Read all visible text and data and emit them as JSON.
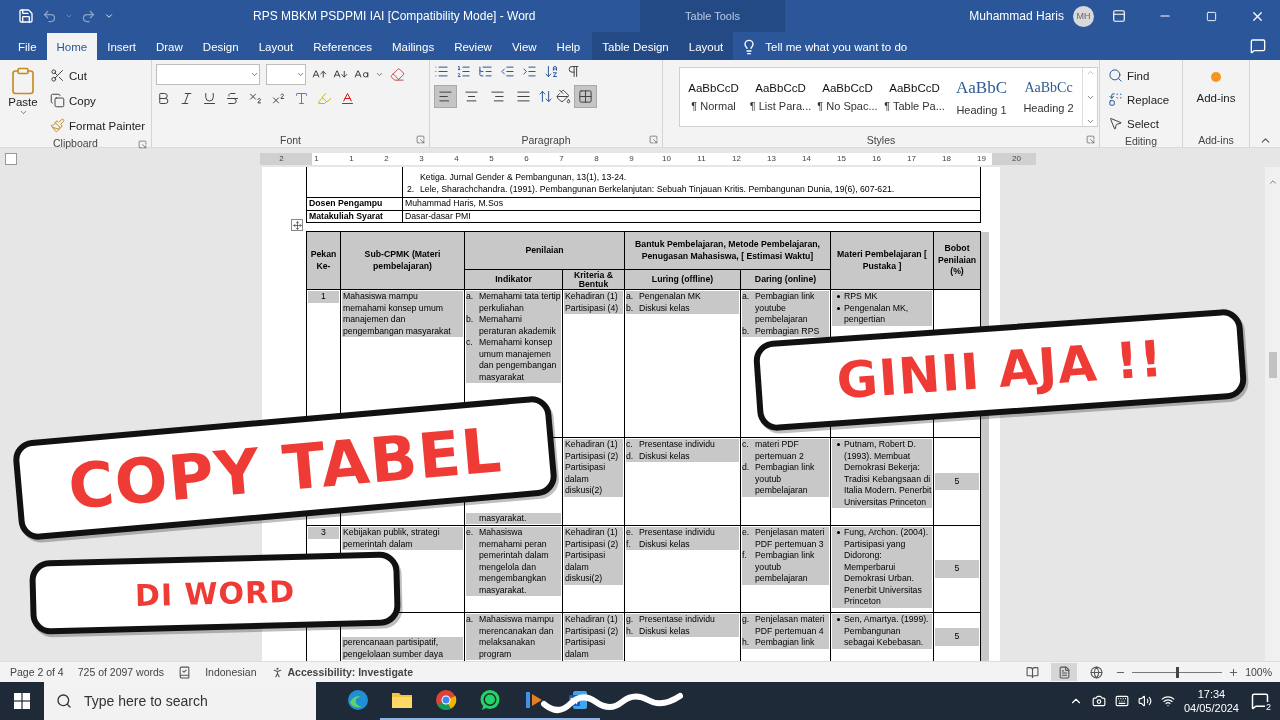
{
  "window": {
    "title": "RPS MBKM PSDPMI IAI [Compatibility Mode]  -  Word",
    "context_group": "Table Tools",
    "user": "Muhammad Haris",
    "initials": "MH"
  },
  "tabs": [
    {
      "label": "File",
      "selected": false,
      "kind": "main"
    },
    {
      "label": "Home",
      "selected": true,
      "kind": "main"
    },
    {
      "label": "Insert",
      "selected": false,
      "kind": "main"
    },
    {
      "label": "Draw",
      "selected": false,
      "kind": "main"
    },
    {
      "label": "Design",
      "selected": false,
      "kind": "main"
    },
    {
      "label": "Layout",
      "selected": false,
      "kind": "main"
    },
    {
      "label": "References",
      "selected": false,
      "kind": "main"
    },
    {
      "label": "Mailings",
      "selected": false,
      "kind": "main"
    },
    {
      "label": "Review",
      "selected": false,
      "kind": "main"
    },
    {
      "label": "View",
      "selected": false,
      "kind": "main"
    },
    {
      "label": "Help",
      "selected": false,
      "kind": "main"
    },
    {
      "label": "Table Design",
      "selected": false,
      "kind": "context"
    },
    {
      "label": "Layout",
      "selected": false,
      "kind": "context"
    }
  ],
  "tell_me": {
    "placeholder": "Tell me what you want to do"
  },
  "clipboard": {
    "label": "Clipboard",
    "paste": "Paste",
    "actions": [
      {
        "label": "Cut",
        "kind": "cut"
      },
      {
        "label": "Copy",
        "kind": "copy"
      },
      {
        "label": "Format Painter",
        "kind": "painter"
      }
    ]
  },
  "font": {
    "label": "Font"
  },
  "paragraph": {
    "label": "Paragraph"
  },
  "styles": {
    "label": "Styles",
    "items": [
      {
        "preview": "AaBbCcD",
        "name": "¶ Normal",
        "kind": "body"
      },
      {
        "preview": "AaBbCcD",
        "name": "¶ List Para...",
        "kind": "body"
      },
      {
        "preview": "AaBbCcD",
        "name": "¶ No Spac...",
        "kind": "body"
      },
      {
        "preview": "AaBbCcD",
        "name": "¶ Table Pa...",
        "kind": "body"
      },
      {
        "preview": "AaBbC",
        "name": "Heading 1",
        "kind": "heading1"
      },
      {
        "preview": "AaBbCc",
        "name": "Heading 2",
        "kind": "heading2"
      }
    ]
  },
  "editing": {
    "label": "Editing",
    "actions": [
      {
        "label": "Find",
        "kind": "find"
      },
      {
        "label": "Replace",
        "kind": "replace"
      },
      {
        "label": "Select",
        "kind": "select"
      }
    ]
  },
  "addins": {
    "label": "Add-ins",
    "button": "Add-ins"
  },
  "ruler": {
    "numbers": [
      "2",
      "1",
      "1",
      "2",
      "3",
      "4",
      "5",
      "6",
      "7",
      "8",
      "9",
      "10",
      "11",
      "12",
      "13",
      "14",
      "15",
      "16",
      "17",
      "18",
      "19",
      "20"
    ]
  },
  "document": {
    "references": [
      {
        "text": "Ketiga. Jurnal Gender & Pembangunan, 13(1), 13-24."
      },
      {
        "marker": "2.",
        "text": "Lele, Sharachchandra. (1991). Pembangunan Berkelanjutan: Sebuah Tinjauan Kritis. Pembangunan Dunia, 19(6), 607-621."
      }
    ],
    "info_rows": [
      {
        "label": "Dosen Pengampu",
        "value": "Muhammad Haris, M.Sos"
      },
      {
        "label": "Matakuliah Syarat",
        "value": "Dasar-dasar PMI"
      }
    ],
    "rps_table": {
      "headers": {
        "week": "Pekan Ke-",
        "sub_cpmk": "Sub-CPMK (Materi pembelajaran)",
        "assessment": "Penilaian",
        "indicator": "Indikator",
        "criteria": "Kriteria & Bentuk",
        "method": "Bantuk Pembelajaran, Metode Pembelajaran, Penugasan Mahasiswa, [ Estimasi Waktu]",
        "offline": "Luring (offline)",
        "online": "Daring (online)",
        "material": "Materi Pembelajaran [ Pustaka ]",
        "weight": "Bobot Penilaian (%)"
      },
      "rows": [
        {
          "week": "1",
          "sub_cpmk": "Mahasiswa mampu memahami konsep umum manajemen dan pengembangan masyarakat",
          "indicators": [
            {
              "marker": "a.",
              "text": "Memahami tata tertip perkuliahan"
            },
            {
              "marker": "b.",
              "text": "Memahami peraturan akademik"
            },
            {
              "marker": "c.",
              "text": "Memahami konsep umum manajemen dan pengembangan masyarakat"
            }
          ],
          "criteria": [
            "Kehadiran (1)",
            "Partisipasi (4)"
          ],
          "offline": [
            {
              "marker": "a.",
              "text": "Pengenalan MK"
            },
            {
              "marker": "b.",
              "text": "Diskusi kelas"
            }
          ],
          "online": [
            {
              "marker": "a.",
              "text": "Pembagian link youtube pembelajaran"
            },
            {
              "marker": "b.",
              "text": "Pembagian RPS"
            }
          ],
          "materials": [
            "RPS MK",
            "Pengenalan MK, pengertian"
          ]
        },
        {
          "indicators": [
            {
              "text": "masyarakat."
            }
          ],
          "criteria": [
            "Kehadiran (1)",
            "Partisipasi (2)",
            "Partisipasi dalam diskusi(2)"
          ],
          "offline": [
            {
              "marker": "c.",
              "text": "Presentase individu"
            },
            {
              "marker": "d.",
              "text": "Diskusi kelas"
            }
          ],
          "online": [
            {
              "marker": "c.",
              "text": "materi PDF pertemuan 2"
            },
            {
              "marker": "d.",
              "text": "Pembagian link youtub pembelajaran"
            }
          ],
          "materials": [
            "Putnam, Robert D. (1993). Membuat Demokrasi Bekerja: Tradisi Kebangsaan di Italia Modern. Penerbit Universitas Princeton"
          ],
          "weight": "5"
        },
        {
          "week": "3",
          "sub_cpmk": "Kebijakan publik, strategi pemerintah dalam",
          "indicators": [
            {
              "marker": "e.",
              "text": "Mahasiswa memahami peran pemerintah dalam mengelola dan mengembangkan masyarakat."
            }
          ],
          "criteria": [
            "Kehadiran (1)",
            "Partisipasi (2)",
            "Partisipasi dalam diskusi(2)"
          ],
          "offline": [
            {
              "marker": "e.",
              "text": "Presentase individu"
            },
            {
              "marker": "f.",
              "text": "Diskusi kelas"
            }
          ],
          "online": [
            {
              "marker": "e.",
              "text": "Penjelasan materi PDF pertemuan 3"
            },
            {
              "marker": "f.",
              "text": "Pembagian link youtub pembelajaran"
            }
          ],
          "materials": [
            "Fung, Archon. (2004). Partisipasi yang Didorong: Memperbarui Demokrasi Urban. Penerbit Universitas Princeton"
          ],
          "weight": "5"
        },
        {
          "sub_cpmk": "perencanaan partisipatif, pengelolaan sumber daya",
          "indicators": [
            {
              "marker": "a.",
              "text": "Mahasiswa mampu merencanakan dan melaksanakan program"
            }
          ],
          "criteria": [
            "Kehadiran (1)",
            "Partisipasi (2)",
            "Partisipasi dalam"
          ],
          "offline": [
            {
              "marker": "g.",
              "text": "Presentase individu"
            },
            {
              "marker": "h.",
              "text": "Diskusi kelas"
            }
          ],
          "online": [
            {
              "marker": "g.",
              "text": "Penjelasan materi PDF pertemuan 4"
            },
            {
              "marker": "h.",
              "text": "Pembagian link"
            }
          ],
          "materials": [
            "Sen, Amartya. (1999). Pembangunan sebagai Kebebasan."
          ],
          "weight": "5"
        }
      ]
    }
  },
  "status_bar": {
    "page": "Page 2 of 4",
    "words": "725 of 2097 words",
    "language": "Indonesian",
    "accessibility": "Accessibility: Investigate",
    "zoom": {
      "level": 0.5,
      "reading": "100%"
    }
  },
  "taskbar": {
    "search": {
      "placeholder": "Type here to search"
    },
    "time": "17:34",
    "date": "04/05/2024",
    "notifications": "2"
  },
  "stickers": [
    {
      "text": "COPY TABEL"
    },
    {
      "text": "GINII AJA !!"
    },
    {
      "text": "DI WORD"
    }
  ]
}
